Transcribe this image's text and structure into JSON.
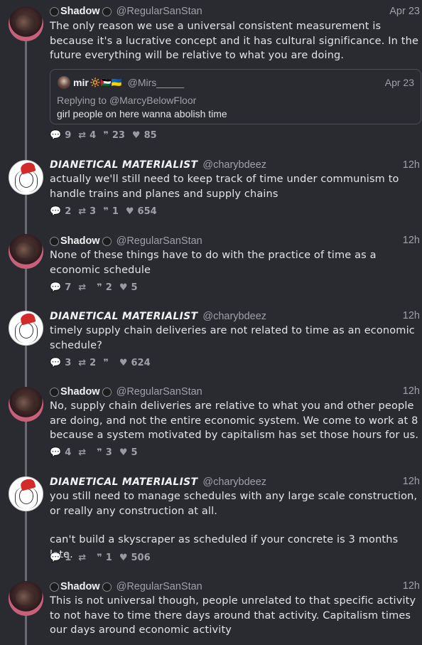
{
  "posts": [
    {
      "name": "Shadow",
      "handle": "@RegularSanStan",
      "time": "Apr 23",
      "text": "The only reason we use a universal consistent measurement is because it's a lucrative concept and it has cultural significance. In the future everything will be relative to what you are doing.",
      "quote": {
        "name": "mir",
        "flags": "🔆🇵🇸🇺🇦",
        "handle": "@Mirs_____",
        "time": "Apr 23",
        "replying_prefix": "Replying to ",
        "replying_to": "@MarcyBelowFloor",
        "text": "girl people on here wanna abolish time"
      },
      "replies": "9",
      "reposts": "4",
      "quotes": "23",
      "likes": "85"
    },
    {
      "name": "DIANETICAL MATERIALIST",
      "handle": "@charybdeez",
      "time": "12h",
      "text": "actually we'll still need to keep track of time under communism to handle trains and planes and supply chains",
      "replies": "2",
      "reposts": "3",
      "quotes": "1",
      "likes": "654"
    },
    {
      "name": "Shadow",
      "handle": "@RegularSanStan",
      "time": "12h",
      "text": "None of these things have to do with the practice of time as a economic schedule",
      "replies": "7",
      "reposts": "",
      "quotes": "2",
      "likes": "5"
    },
    {
      "name": "DIANETICAL MATERIALIST",
      "handle": "@charybdeez",
      "time": "12h",
      "text": "timely supply chain deliveries are not related to time as an economic schedule?",
      "replies": "3",
      "reposts": "2",
      "quotes": "",
      "likes": "624"
    },
    {
      "name": "Shadow",
      "handle": "@RegularSanStan",
      "time": "12h",
      "text": "No, supply chain deliveries are relative to what you and other people are doing, and not the entire economic system. We come to work at 8 because a system motivated by capitalism has set those hours for us.",
      "replies": "4",
      "reposts": "",
      "quotes": "3",
      "likes": "5"
    },
    {
      "name": "DIANETICAL MATERIALIST",
      "handle": "@charybdeez",
      "time": "12h",
      "text": "you still need to manage schedules with any large scale construction, or really any construction at all.",
      "text2": "can't build a skyscraper as scheduled if your concrete is 3 months late.",
      "replies": "1",
      "reposts": "",
      "quotes": "1",
      "likes": "506"
    },
    {
      "name": "Shadow",
      "handle": "@RegularSanStan",
      "time": "12h",
      "text": "This is not universal though, people unrelated to that specific activity to not have to time there days around that activity. Capitalism times our days around economic activity"
    }
  ],
  "icons": {
    "reply": "speech-bubble-icon",
    "repost": "repost-arrows-icon",
    "quote": "quote-marks-icon",
    "like": "heart-icon"
  },
  "colors": {
    "background": "#2a2b31",
    "thread_line": "#6a6b72",
    "muted": "#a0a0a8"
  }
}
